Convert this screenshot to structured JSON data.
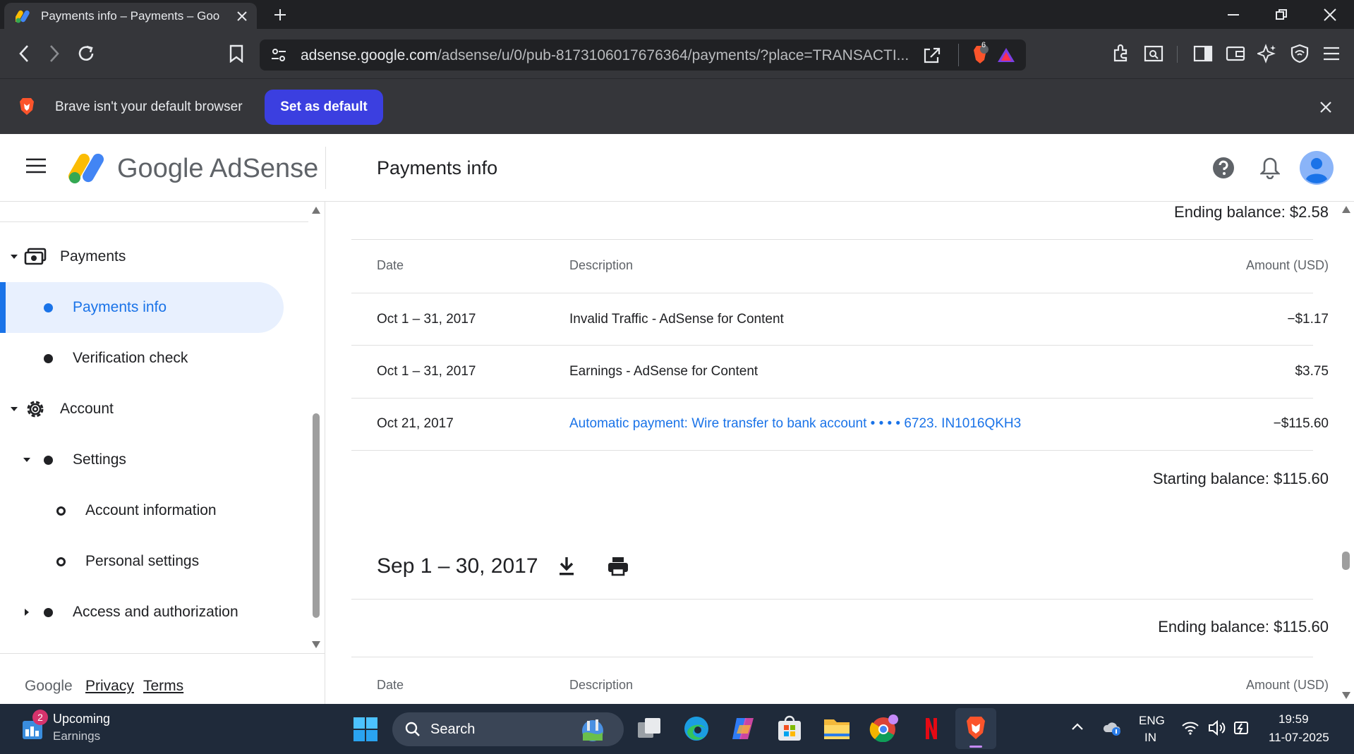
{
  "browser": {
    "tab_title": "Payments info – Payments – Goo",
    "url_host": "adsense.google.com",
    "url_path": "/adsense/u/0/pub-8173106017676364/payments/?place=TRANSACTI...",
    "brave_badge": "6"
  },
  "infobar": {
    "message": "Brave isn't your default browser",
    "button_label": "Set as default"
  },
  "app": {
    "brand": "Google AdSense",
    "page_title": "Payments info"
  },
  "sidebar": {
    "items": [
      {
        "label": "Payments"
      },
      {
        "label": "Payments info"
      },
      {
        "label": "Verification check"
      },
      {
        "label": "Account"
      },
      {
        "label": "Settings"
      },
      {
        "label": "Account information"
      },
      {
        "label": "Personal settings"
      },
      {
        "label": "Access and authorization"
      }
    ],
    "footer": {
      "google": "Google",
      "privacy": "Privacy",
      "terms": "Terms"
    }
  },
  "main": {
    "oct": {
      "ending_balance": "Ending balance: $2.58",
      "headers": {
        "date": "Date",
        "description": "Description",
        "amount": "Amount (USD)"
      },
      "rows": [
        {
          "date": "Oct 1 – 31, 2017",
          "description": "Invalid Traffic - AdSense for Content",
          "amount": "−$1.17"
        },
        {
          "date": "Oct 1 – 31, 2017",
          "description": "Earnings - AdSense for Content",
          "amount": "$3.75"
        },
        {
          "date": "Oct 21, 2017",
          "description": "Automatic payment: Wire transfer to bank account  • • • • 6723. IN1016QKH3",
          "amount": "−$115.60"
        }
      ],
      "starting_balance": "Starting balance: $115.60"
    },
    "sep": {
      "period": "Sep 1 – 30, 2017",
      "ending_balance": "Ending balance: $115.60",
      "headers": {
        "date": "Date",
        "description": "Description",
        "amount": "Amount (USD)"
      }
    }
  },
  "taskbar": {
    "widget_badge": "2",
    "widget_title": "Upcoming",
    "widget_subtitle": "Earnings",
    "search_label": "Search",
    "lang_1": "ENG",
    "lang_2": "IN",
    "time": "19:59",
    "date": "11-07-2025"
  }
}
